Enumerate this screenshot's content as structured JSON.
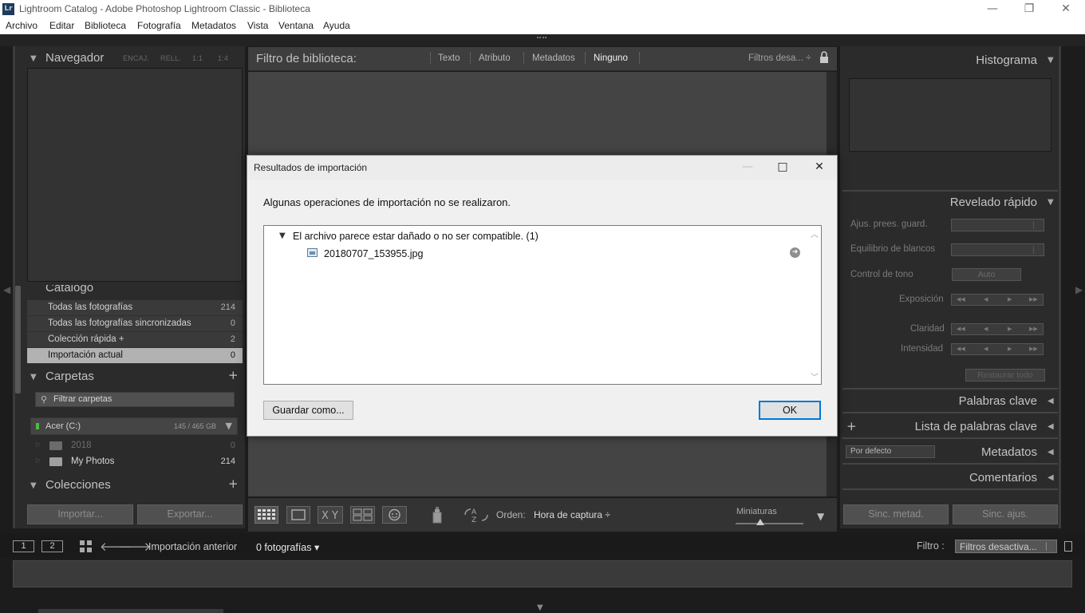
{
  "window": {
    "title": "Lightroom Catalog - Adobe Photoshop Lightroom Classic - Biblioteca",
    "logo_text": "Lr",
    "minimize": "—",
    "maximize": "❐",
    "close": "✕"
  },
  "menu": [
    "Archivo",
    "Editar",
    "Biblioteca",
    "Fotografía",
    "Metadatos",
    "Vista",
    "Ventana",
    "Ayuda"
  ],
  "left_panel": {
    "navigator": {
      "title": "Navegador",
      "options": [
        "ENCAJ.",
        "RELL.",
        "1:1",
        "1:4"
      ]
    },
    "catalog": {
      "title": "Catálogo",
      "items": [
        {
          "label": "Todas las fotografías",
          "count": "214"
        },
        {
          "label": "Todas las fotografías sincronizadas",
          "count": "0"
        },
        {
          "label": "Colección rápida  +",
          "count": "2"
        },
        {
          "label": "Importación actual",
          "count": "0"
        }
      ]
    },
    "folders": {
      "title": "Carpetas",
      "filter_placeholder": "Filtrar carpetas",
      "volume": {
        "name": "Acer (C:)",
        "size": "145 / 465 GB"
      },
      "items": [
        {
          "name": "2018",
          "count": "0"
        },
        {
          "name": "My Photos",
          "count": "214"
        }
      ]
    },
    "collections": {
      "title": "Colecciones"
    },
    "import_button": "Importar...",
    "export_button": "Exportar..."
  },
  "filter_bar": {
    "title": "Filtro de biblioteca:",
    "options": [
      "Texto",
      "Atributo",
      "Metadatos",
      "Ninguno"
    ],
    "active": "Ninguno",
    "preset": "Filtros desa... ÷"
  },
  "toolbar": {
    "sort_label": "Orden:",
    "sort_value": "Hora de captura ÷",
    "thumbnails_label": "Miniaturas",
    "view_icons": [
      "grid-view-icon",
      "loupe-view-icon",
      "compare-view-icon",
      "survey-view-icon",
      "people-view-icon",
      "spray-can-icon",
      "sort-direction-icon"
    ]
  },
  "right_panel": {
    "histogram": "Histograma",
    "quick_develop": {
      "title": "Revelado rápido",
      "saved_preset": "Ajus. prees. guard.",
      "white_balance": "Equilibrio de blancos",
      "tone_control": "Control de tono",
      "auto": "Auto",
      "exposure": "Exposición",
      "clarity": "Claridad",
      "vibrance": "Intensidad",
      "reset": "Restaurar todo"
    },
    "keywording": "Palabras clave",
    "keyword_list": "Lista de palabras clave",
    "metadata": "Metadatos",
    "metadata_preset": "Por defecto",
    "comments": "Comentarios",
    "sync_metadata": "Sinc. metad.",
    "sync_settings": "Sinc. ajus."
  },
  "filmstrip": {
    "screen1": "1",
    "screen2": "2",
    "source": "Importación anterior",
    "count": "0 fotografías ▾",
    "filter_label": "Filtro :",
    "filter_value": "Filtros desactiva..."
  },
  "dialog": {
    "title": "Resultados de importación",
    "message": "Algunas operaciones de importación no se realizaron.",
    "group_label": "El archivo parece estar dañado o no ser compatible. (1)",
    "file": "20180707_153955.jpg",
    "save_button": "Guardar como...",
    "ok_button": "OK"
  },
  "colors": {
    "dialog_focus": "#0078d7",
    "panel_bg": "#2b2b2b",
    "grid_bg": "#444444",
    "volume_led": "#4cba45"
  }
}
